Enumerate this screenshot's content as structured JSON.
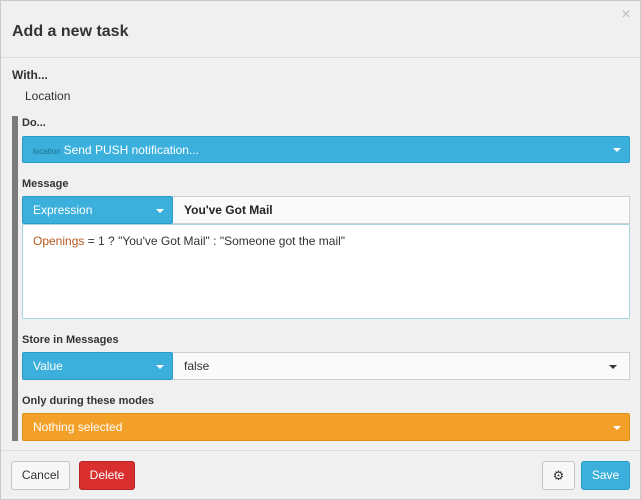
{
  "dialog": {
    "title": "Add a new task",
    "close_glyph": "×"
  },
  "with": {
    "label": "With...",
    "value": "Location"
  },
  "do": {
    "label": "Do...",
    "prefix": "location",
    "value": "Send PUSH notification..."
  },
  "message": {
    "label": "Message",
    "type": "Expression",
    "value": "You've Got Mail",
    "expression": {
      "variable": "Openings",
      "rest": " = 1 ? \"You've Got Mail\" : \"Someone got the mail\""
    }
  },
  "store": {
    "label": "Store in Messages",
    "type": "Value",
    "value": "false"
  },
  "modes": {
    "label": "Only during these modes",
    "value": "Nothing selected"
  },
  "buttons": {
    "cancel": "Cancel",
    "delete": "Delete",
    "gear": "⚙",
    "save": "Save"
  },
  "colors": {
    "accent_blue": "#3bb0dc",
    "accent_orange": "#f2a027",
    "danger_red": "#d9302f"
  },
  "icons": {
    "close": "close-icon",
    "caret": "caret-down-icon",
    "settings": "gear-icon"
  }
}
